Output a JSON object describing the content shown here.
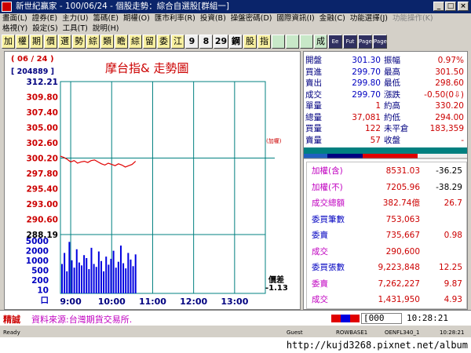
{
  "window": {
    "title": "新世紀贏家 - 100/06/24 - 個股走勢：綜合自選股[群組一]"
  },
  "menu1": [
    "畫面(L)",
    "證券(E)",
    "主力(U)",
    "籌碼(E)",
    "期權(O)",
    "匯市利率(R)",
    "投資(B)",
    "操盤密碼(D)",
    "國際資訊(I)",
    "金融(C)",
    "功能選擇(J)",
    "功能操作(K)"
  ],
  "menu2": [
    "格視(Y)",
    "設定(S)",
    "工具(T)",
    "說明(H)"
  ],
  "toolbar": {
    "buttons": [
      "加",
      "權",
      "期",
      "價",
      "選",
      "勢",
      "綜",
      "類",
      "瞻",
      "綜",
      "留",
      "委",
      "江",
      "9",
      "8",
      "29",
      "鋼",
      "股",
      "指",
      "",
      "",
      "",
      "成",
      "Ee",
      "Fut",
      "Page",
      "Page"
    ]
  },
  "chart": {
    "date_label": "( 06 / 24 )",
    "volume_label": "[ 204889 ]",
    "title": "摩台指& 走勢圖",
    "ref_label": "(加權)",
    "ylabels": [
      "312.21",
      "309.80",
      "307.40",
      "305.00",
      "302.60",
      "300.20",
      "297.80",
      "295.40",
      "293.00",
      "290.60",
      "288.19"
    ],
    "vol_labels": [
      "5000",
      "2000",
      "1000",
      "500",
      "200",
      "10",
      "口"
    ],
    "xlabels": [
      "9:00",
      "10:00",
      "11:00",
      "12:00",
      "13:00"
    ],
    "spread_label": "價差",
    "spread_value": "-1.13"
  },
  "chart_data": {
    "type": "line",
    "ylim": [
      288.19,
      312.21
    ],
    "reference": 300.2,
    "time_range": [
      "08:45",
      "13:45"
    ],
    "price_series": [
      {
        "t": "08:45",
        "v": 300.5
      },
      {
        "t": "08:50",
        "v": 300.3
      },
      {
        "t": "08:55",
        "v": 300.0
      },
      {
        "t": "09:00",
        "v": 299.6
      },
      {
        "t": "09:05",
        "v": 299.8
      },
      {
        "t": "09:10",
        "v": 299.4
      },
      {
        "t": "09:15",
        "v": 299.6
      },
      {
        "t": "09:20",
        "v": 299.7
      },
      {
        "t": "09:25",
        "v": 299.5
      },
      {
        "t": "09:30",
        "v": 299.8
      },
      {
        "t": "09:35",
        "v": 299.9
      },
      {
        "t": "09:40",
        "v": 299.6
      },
      {
        "t": "09:45",
        "v": 299.3
      },
      {
        "t": "09:50",
        "v": 299.1
      },
      {
        "t": "09:55",
        "v": 299.4
      },
      {
        "t": "10:00",
        "v": 299.2
      },
      {
        "t": "10:05",
        "v": 299.0
      },
      {
        "t": "10:10",
        "v": 299.3
      },
      {
        "t": "10:15",
        "v": 299.1
      },
      {
        "t": "10:20",
        "v": 298.8
      },
      {
        "t": "10:25",
        "v": 299.0
      },
      {
        "t": "10:30",
        "v": 299.2
      },
      {
        "t": "10:35",
        "v": 299.7
      }
    ],
    "volume_series": [
      40,
      55,
      30,
      70,
      45,
      35,
      60,
      42,
      38,
      52,
      48,
      33,
      62,
      40,
      36,
      57,
      44,
      30,
      50,
      39,
      47,
      58,
      35,
      43,
      65,
      41,
      34,
      55,
      46,
      37,
      53
    ]
  },
  "info": {
    "rows": [
      {
        "l1": "開盤",
        "v1": "301.30",
        "l2": "振幅",
        "v2": "0.97%"
      },
      {
        "l1": "買進",
        "v1": "299.70",
        "l2": "最高",
        "v2": "301.50"
      },
      {
        "l1": "賣出",
        "v1": "299.80",
        "l2": "最低",
        "v2": "298.60"
      },
      {
        "l1": "成交",
        "v1": "299.70",
        "l2": "漲跌",
        "v2": "-0.50(0⇩)"
      },
      {
        "l1": "單量",
        "v1": "1",
        "l2": "約高",
        "v2": "330.20"
      },
      {
        "l1": "總量",
        "v1": "37,081",
        "l2": "約低",
        "v2": "294.00"
      },
      {
        "l1": "買量",
        "v1": "122",
        "l2": "未平倉",
        "v2": "183,359"
      },
      {
        "l1": "賣量",
        "v1": "57",
        "l2": "收盤",
        "v2": "-"
      }
    ],
    "detail": [
      {
        "l": "加權(含)",
        "v": "8531.03",
        "c": "-36.25"
      },
      {
        "l": "加權(不)",
        "v": "7205.96",
        "c": "-38.29"
      },
      {
        "l": "成交總額",
        "v": "382.74億",
        "c": "26.7"
      },
      {
        "l": "委買筆數",
        "v": "753,063",
        "c": ""
      },
      {
        "l": "委賣",
        "v": "735,667",
        "c": "0.98"
      },
      {
        "l": "成交",
        "v": "290,600",
        "c": ""
      },
      {
        "l": "委買張數",
        "v": "9,223,848",
        "c": "12.25"
      },
      {
        "l": "委賣",
        "v": "7,262,227",
        "c": "9.87"
      },
      {
        "l": "成交",
        "v": "1,431,950",
        "c": "4.93"
      }
    ]
  },
  "status": {
    "tag": "精誠",
    "source": "資料來源:台灣期貨交易所.",
    "code": "[000",
    "time": "10:28:21"
  },
  "winstatus": {
    "ready": "Ready",
    "guest": "Guest",
    "rb": "ROWBASE1",
    "srv": "OENFL340_1",
    "clock": "10:28:21"
  },
  "footer": {
    "url": "http://kujd3268.pixnet.net/album"
  }
}
